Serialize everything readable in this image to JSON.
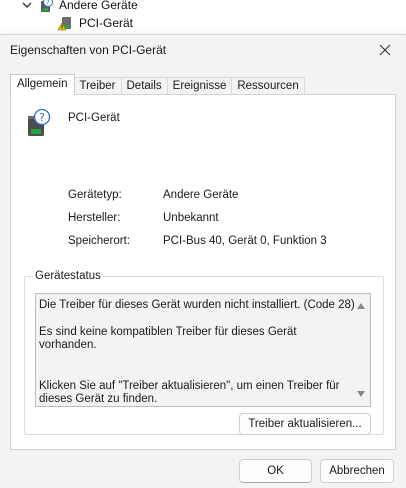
{
  "tree": {
    "category_label": "Andere Geräte",
    "device_label": "PCI-Gerät"
  },
  "dialog": {
    "title": "Eigenschaften von PCI-Gerät",
    "tabs": [
      {
        "label": "Allgemein",
        "active": true
      },
      {
        "label": "Treiber",
        "active": false
      },
      {
        "label": "Details",
        "active": false
      },
      {
        "label": "Ereignisse",
        "active": false
      },
      {
        "label": "Ressourcen",
        "active": false
      }
    ],
    "device_name": "PCI-Gerät",
    "properties": [
      {
        "key": "Gerätetyp:",
        "value": "Andere Geräte"
      },
      {
        "key": "Hersteller:",
        "value": "Unbekannt"
      },
      {
        "key": "Speicherort:",
        "value": "PCI-Bus 40, Gerät 0, Funktion 3"
      }
    ],
    "status": {
      "group_title": "Gerätestatus",
      "lines": [
        "Die Treiber für dieses Gerät wurden nicht installiert. (Code 28)",
        "Es sind keine kompatiblen Treiber für dieses Gerät vorhanden.",
        "Klicken Sie auf \"Treiber aktualisieren\", um einen Treiber für dieses Gerät zu finden."
      ],
      "update_button": "Treiber aktualisieren..."
    },
    "ok_label": "OK",
    "cancel_label": "Abbrechen"
  },
  "icons": {
    "chevron": "chevron-down-icon",
    "category": "unknown-device-icon",
    "warning_device": "warning-device-icon",
    "close": "close-icon",
    "device": "unknown-device-icon"
  }
}
